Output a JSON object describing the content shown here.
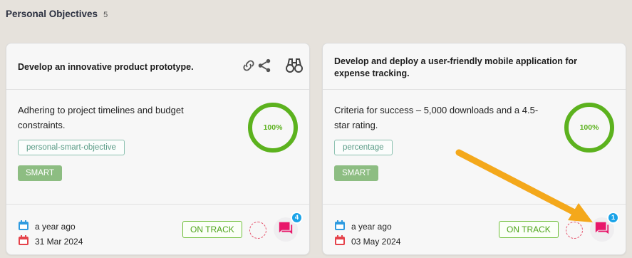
{
  "section": {
    "title": "Personal Objectives",
    "count": "5"
  },
  "cards": [
    {
      "title": "Develop an innovative product prototype.",
      "description": "Adhering to project timelines and budget constraints.",
      "tag": "personal-smart-objective",
      "type_badge": "SMART",
      "progress": {
        "label": "100%",
        "value": 100
      },
      "created": "a year ago",
      "due": "31 Mar 2024",
      "status": "ON TRACK",
      "comments": "4",
      "icons": [
        "link-icon",
        "share-icon",
        "binoculars-icon",
        "calendar-icon",
        "comment-icon"
      ]
    },
    {
      "title": "Develop and deploy a user-friendly mobile application for expense tracking.",
      "description": "Criteria for success – 5,000 downloads and a 4.5-star rating.",
      "tag": "percentage",
      "type_badge": "SMART",
      "progress": {
        "label": "100%",
        "value": 100
      },
      "created": "a year ago",
      "due": "03 May 2024",
      "status": "ON TRACK",
      "comments": "1",
      "icons": [
        "calendar-icon",
        "comment-icon"
      ]
    }
  ],
  "colors": {
    "background": "#e6e2dc",
    "progress": "#5cb21e",
    "status": "#4ea51b",
    "smart": "#8dbd82",
    "badge": "#1aa3e8",
    "comment": "#e8176a",
    "arrow": "#f4a81b"
  }
}
